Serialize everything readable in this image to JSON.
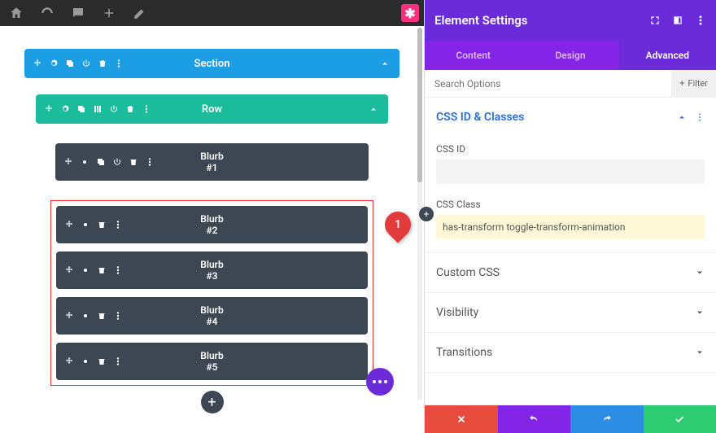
{
  "section_label": "Section",
  "row_label": "Row",
  "blurbs": [
    "Blurb\n#1",
    "Blurb\n#2",
    "Blurb\n#3",
    "Blurb\n#4",
    "Blurb\n#5"
  ],
  "callout_number": "1",
  "panel": {
    "title": "Element Settings",
    "tabs": [
      "Content",
      "Design",
      "Advanced"
    ],
    "active_tab": 2,
    "search_placeholder": "Search Options",
    "filter_label": "Filter",
    "sections": {
      "css_id_classes": "CSS ID & Classes",
      "css_id_label": "CSS ID",
      "css_id_value": "",
      "css_class_label": "CSS Class",
      "css_class_value": "has-transform toggle-transform-animation",
      "custom_css": "Custom CSS",
      "visibility": "Visibility",
      "transitions": "Transitions"
    }
  }
}
